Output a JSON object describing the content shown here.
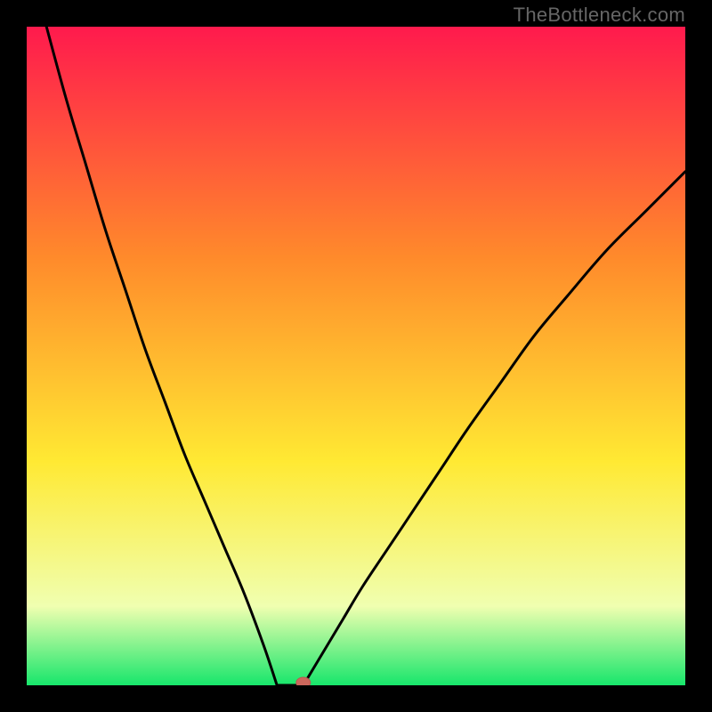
{
  "watermark": {
    "text": "TheBottleneck.com"
  },
  "colors": {
    "frame": "#000000",
    "gradient_top": "#ff1a4d",
    "gradient_mid1": "#ff8a2b",
    "gradient_mid2": "#ffe933",
    "gradient_band": "#f0ffb0",
    "gradient_bottom": "#17e66b",
    "curve": "#000000",
    "marker_fill": "#cc675c",
    "marker_stroke": "#b85a50"
  },
  "chart_data": {
    "type": "line",
    "title": "",
    "xlabel": "",
    "ylabel": "",
    "xlim": [
      0,
      100
    ],
    "ylim": [
      0,
      100
    ],
    "marker": {
      "x": 42,
      "y": 0
    },
    "flat_segment": {
      "x0": 38,
      "x1": 42,
      "y": 0
    },
    "series": [
      {
        "name": "bottleneck-curve-left",
        "x": [
          3,
          6,
          9,
          12,
          15,
          18,
          21,
          24,
          27,
          30,
          33,
          36,
          38
        ],
        "y": [
          100,
          89,
          79,
          69,
          60,
          51,
          43,
          35,
          28,
          21,
          14,
          6,
          0
        ]
      },
      {
        "name": "bottleneck-curve-right",
        "x": [
          42,
          45,
          48,
          51,
          55,
          59,
          63,
          67,
          72,
          77,
          82,
          88,
          94,
          100
        ],
        "y": [
          0,
          5,
          10,
          15,
          21,
          27,
          33,
          39,
          46,
          53,
          59,
          66,
          72,
          78
        ]
      }
    ]
  }
}
